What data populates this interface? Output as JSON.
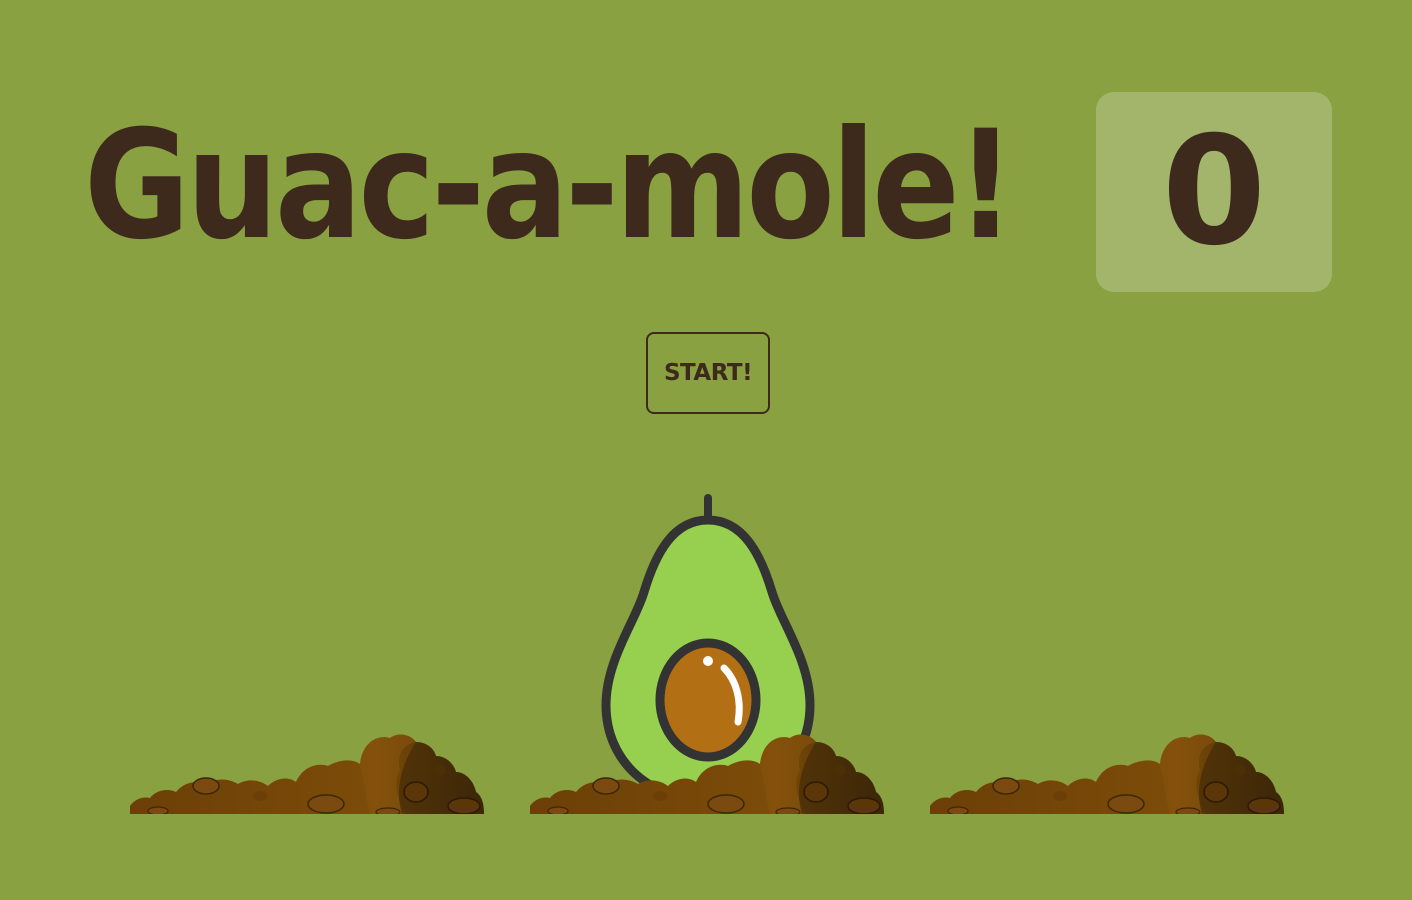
{
  "title": "Guac-a-mole!",
  "score": "0",
  "start_label": "START!",
  "holes": [
    {
      "id": 1,
      "mole_visible": false
    },
    {
      "id": 2,
      "mole_visible": true
    },
    {
      "id": 3,
      "mole_visible": false
    }
  ],
  "colors": {
    "background": "#8aa142",
    "text": "#3d2a1c",
    "avocado_flesh": "#97d04f",
    "avocado_outline": "#333333",
    "pit": "#b36f14",
    "dirt_light": "#7a4a08",
    "dirt_dark": "#3b2708"
  },
  "icons": {
    "mole": "avocado-icon",
    "hole": "dirt-mound-icon"
  }
}
